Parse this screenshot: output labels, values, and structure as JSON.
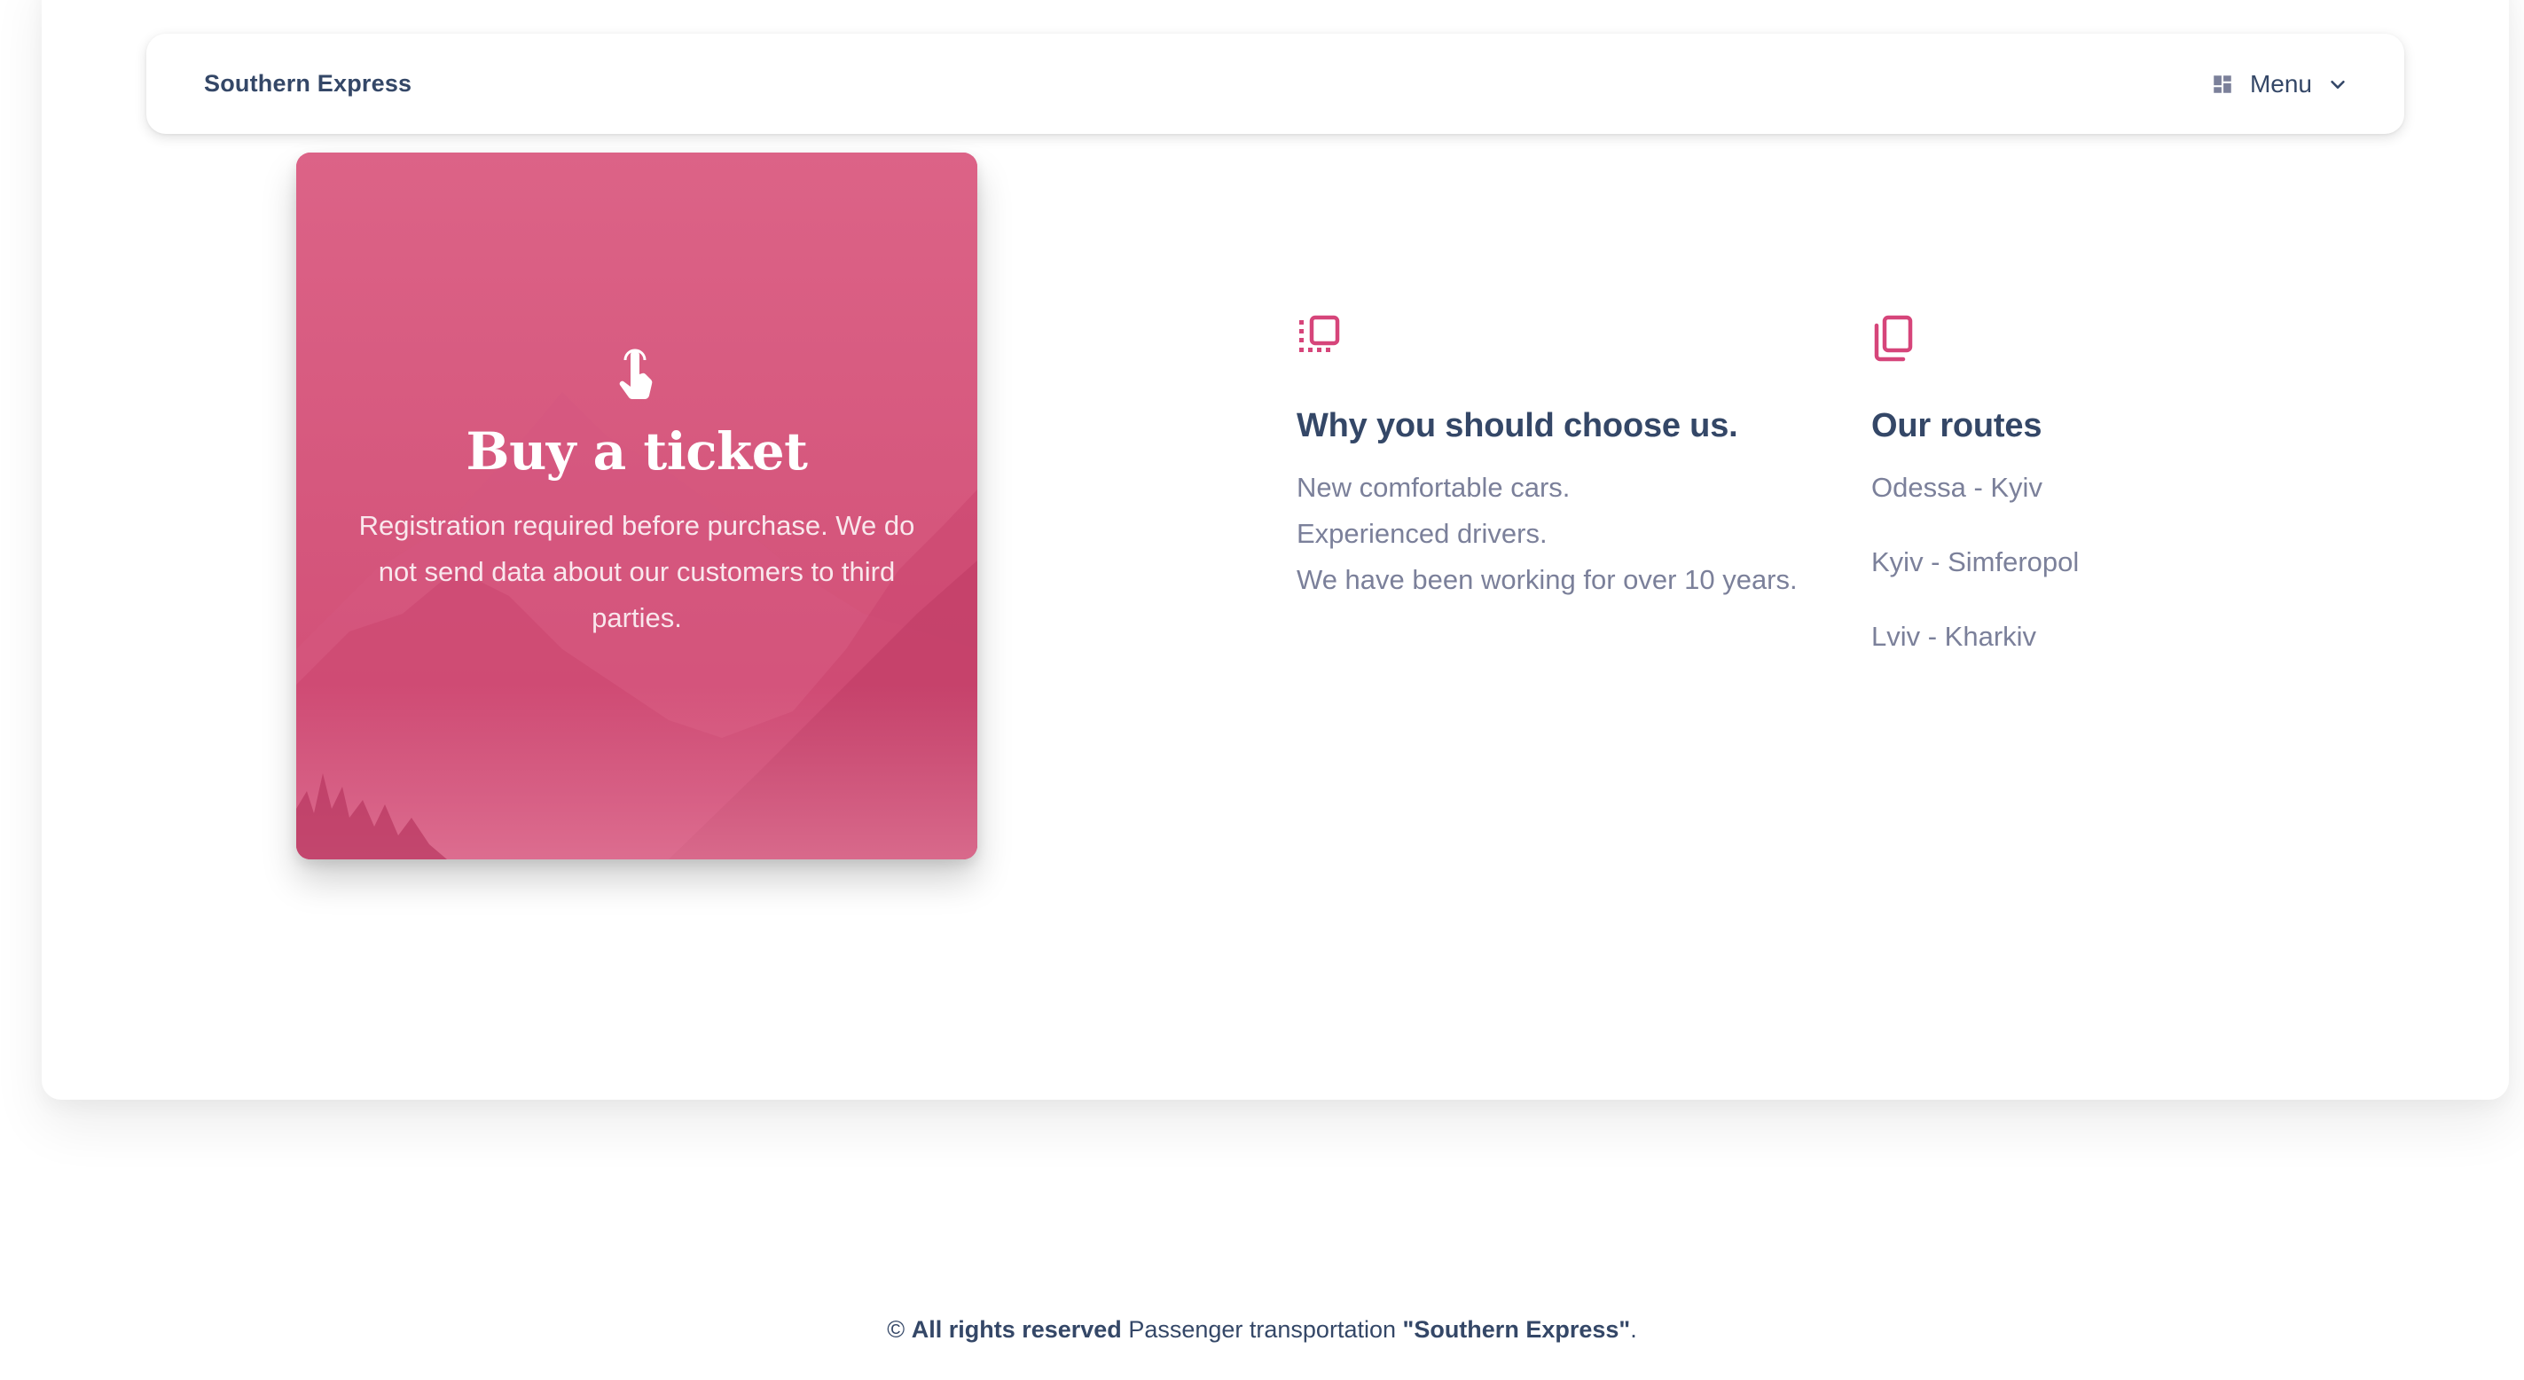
{
  "navbar": {
    "brand": "Southern Express",
    "menu_label": "Menu",
    "menu_icon": "dashboard-grid-icon",
    "chevron_icon": "chevron-down-icon"
  },
  "ticket_card": {
    "icon": "touch-app-icon",
    "title": "Buy a ticket",
    "description": "Registration required before purchase. We do not send data about our customers to third parties."
  },
  "features": [
    {
      "icon": "collections-icon",
      "title": "Why you should choose us.",
      "lines": [
        "New comfortable cars.",
        "Experienced drivers.",
        "We have been working for over 10 years."
      ]
    },
    {
      "icon": "copy-pages-icon",
      "title": "Our routes",
      "lines": [
        "Odessa - Kyiv",
        "Kyiv - Simferopol",
        "Lviv - Kharkiv"
      ]
    }
  ],
  "footer": {
    "copyright": "©",
    "rights": "All rights reserved",
    "text": "Passenger transportation",
    "company": "\"Southern Express\"",
    "suffix": "."
  },
  "colors": {
    "accent": "#d8587f",
    "heading": "#344767",
    "muted": "#7b809a"
  }
}
